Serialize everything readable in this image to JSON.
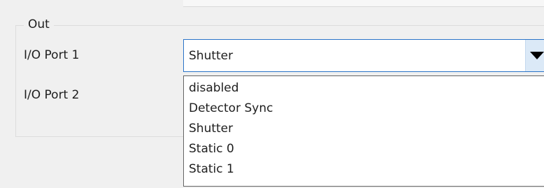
{
  "group": {
    "title": "Out"
  },
  "ports": [
    {
      "label": "I/O Port 1",
      "value": "Shutter"
    },
    {
      "label": "I/O Port 2"
    }
  ],
  "dropdown": {
    "arrow_icon": "triangle-down-icon",
    "options": [
      "disabled",
      "Detector Sync",
      "Shutter",
      "Static 0",
      "Static 1"
    ]
  },
  "colors": {
    "focus_border": "#2a73c8",
    "arrow_button_bg": "#dbe9f7",
    "window_bg": "#f0f0f0"
  }
}
